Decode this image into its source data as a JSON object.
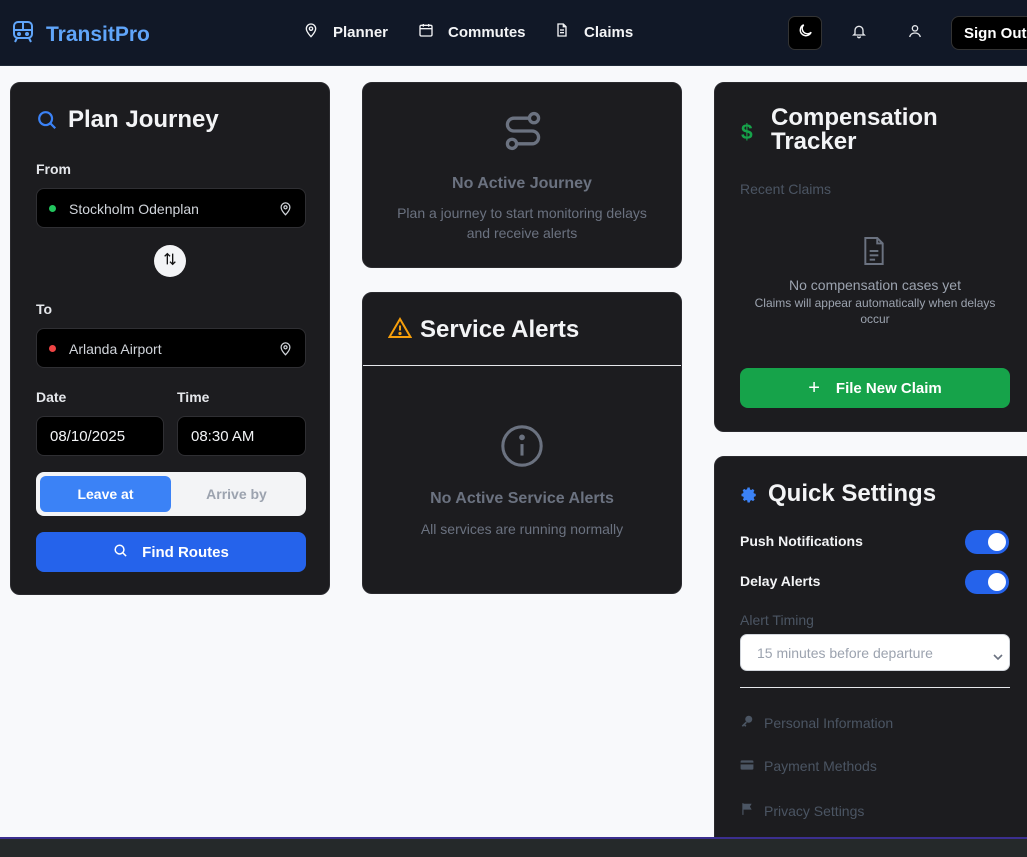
{
  "header": {
    "brand": "TransitPro",
    "nav": [
      {
        "label": "Planner",
        "icon": "map-pin-icon"
      },
      {
        "label": "Commutes",
        "icon": "calendar-icon"
      },
      {
        "label": "Claims",
        "icon": "document-icon"
      }
    ],
    "sign_out": "Sign Out"
  },
  "plan": {
    "title": "Plan Journey",
    "from_label": "From",
    "from_value": "Stockholm Odenplan",
    "to_label": "To",
    "to_value": "Arlanda Airport",
    "date_label": "Date",
    "date_value": "08/10/2025",
    "time_label": "Time",
    "time_value": "08:30 AM",
    "leave_at": "Leave at",
    "arrive_by": "Arrive by",
    "find_routes": "Find Routes"
  },
  "journey": {
    "title": "No Active Journey",
    "line1": "Plan a journey to start monitoring delays",
    "line2": "and receive alerts"
  },
  "alerts": {
    "title": "Service Alerts",
    "empty_title": "No Active Service Alerts",
    "empty_sub": "All services are running normally"
  },
  "comp": {
    "title_line1": "Compensation",
    "title_line2": "Tracker",
    "recent": "Recent Claims",
    "empty_title": "No compensation cases yet",
    "empty_line1": "Claims will appear automatically when delays",
    "empty_line2": "occur",
    "file_claim": "File New Claim"
  },
  "settings": {
    "title": "Quick Settings",
    "push": "Push Notifications",
    "push_on": true,
    "delay": "Delay Alerts",
    "delay_on": true,
    "timing_label": "Alert Timing",
    "timing_value": "15 minutes before departure",
    "links": [
      {
        "label": "Personal Information",
        "icon": "key-icon"
      },
      {
        "label": "Payment Methods",
        "icon": "credit-card-icon"
      },
      {
        "label": "Privacy Settings",
        "icon": "flag-icon"
      }
    ]
  },
  "colors": {
    "accent": "#3b82f6",
    "brand": "#60a5fa",
    "green": "#16a34a",
    "warning": "#f59e0b"
  }
}
